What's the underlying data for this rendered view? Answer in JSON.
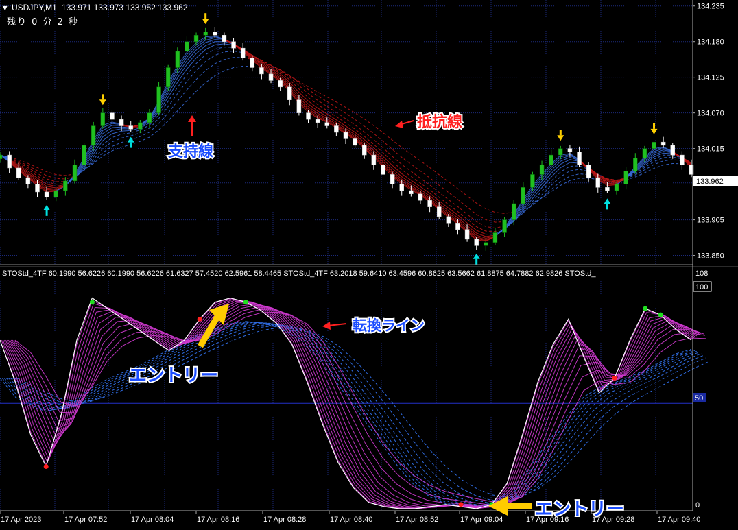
{
  "chart_header": {
    "dropdown_glyph": "▼",
    "symbol_period": "USDJPY,M1",
    "ohlc": "133.971 133.973 133.952 133.962",
    "countdown": "残り 0 分 2 秒"
  },
  "price_axis": {
    "ticks": [
      "134.235",
      "134.180",
      "134.125",
      "134.070",
      "134.015",
      "133.962",
      "133.905",
      "133.850"
    ],
    "current_price": "133.962"
  },
  "indicator_header": {
    "text": "STOStd_4TF 60.1990 56.6226 60.1990 56.6226 61.6327 57.4520 62.5961 58.4465   STOStd_4TF 63.2018 59.6410 63.4596 60.8625 63.5662 61.8875 64.7882 62.9826   STOStd_",
    "max_label": "108"
  },
  "indicator_axis": {
    "top": "100",
    "mid": "50",
    "bottom": "0"
  },
  "time_axis": {
    "labels": [
      "17 Apr 2023",
      "17 Apr 07:52",
      "17 Apr 08:04",
      "17 Apr 08:16",
      "17 Apr 08:28",
      "17 Apr 08:40",
      "17 Apr 08:52",
      "17 Apr 09:04",
      "17 Apr 09:16",
      "17 Apr 09:28",
      "17 Apr 09:40"
    ]
  },
  "annotations": {
    "support": "支持線",
    "resistance": "抵抗線",
    "turning_line": "転換ライン",
    "entry_1": "エントリー",
    "entry_2": "エントリー"
  },
  "colors": {
    "background": "#000000",
    "grid": "#1c2a7a",
    "bull_candle": "#20c020",
    "bear_candle": "#ffffff",
    "resistance_band": "#c81818",
    "support_band": "#3a6fe0",
    "stoch_fast": "#d03ad0",
    "stoch_slow": "#2f6be0",
    "sell_arrow": "#ffd000",
    "buy_arrow": "#00e0e0",
    "annotation_blue": "#1a4cff",
    "annotation_red": "#ff2020",
    "entry_arrow": "#ffcc00"
  },
  "chart_data": [
    {
      "type": "candlestick",
      "title": "USDJPY,M1",
      "ylim": [
        133.84,
        134.24
      ],
      "yticks": [
        134.235,
        134.18,
        134.125,
        134.07,
        134.015,
        133.962,
        133.905,
        133.85
      ],
      "close_series": [
        134.005,
        133.985,
        133.97,
        133.96,
        133.948,
        133.94,
        133.95,
        133.965,
        133.99,
        134.02,
        134.05,
        134.07,
        134.06,
        134.05,
        134.045,
        134.055,
        134.07,
        134.11,
        134.14,
        134.165,
        134.18,
        134.19,
        134.195,
        134.19,
        134.18,
        134.17,
        134.155,
        134.14,
        134.13,
        134.12,
        134.11,
        134.09,
        134.07,
        134.06,
        134.055,
        134.05,
        134.04,
        134.03,
        134.02,
        134.005,
        133.99,
        133.975,
        133.96,
        133.95,
        133.945,
        133.935,
        133.925,
        133.91,
        133.9,
        133.89,
        133.875,
        133.865,
        133.87,
        133.885,
        133.905,
        133.93,
        133.955,
        133.975,
        133.99,
        134.005,
        134.015,
        134.01,
        133.99,
        133.97,
        133.955,
        133.95,
        133.96,
        133.98,
        134.0,
        134.015,
        134.025,
        134.02,
        134.005,
        133.99,
        133.975
      ]
    },
    {
      "type": "line",
      "title": "STOStd_4TF",
      "ylim": [
        0,
        108
      ],
      "yticks": [
        100,
        50,
        0
      ],
      "series": [
        {
          "name": "",
          "values": [
            80,
            60,
            35,
            20,
            45,
            80,
            100,
            95,
            90,
            85,
            80,
            75,
            80,
            90,
            98,
            100,
            98,
            94,
            88,
            78,
            60,
            40,
            22,
            10,
            3,
            1,
            0,
            0,
            1,
            2,
            1,
            0,
            2,
            12,
            35,
            60,
            78,
            90,
            72,
            55,
            62,
            80,
            95,
            92,
            85,
            80
          ]
        },
        {
          "name": "",
          "values": [
            62,
            52,
            48,
            46,
            48,
            53,
            58,
            62,
            65,
            68,
            72,
            76,
            80,
            83,
            86,
            88,
            89,
            88,
            86,
            82,
            76,
            68,
            58,
            48,
            38,
            28,
            18,
            10,
            5,
            2,
            1,
            1,
            3,
            8,
            16,
            26,
            36,
            46,
            54,
            58,
            60,
            63,
            66,
            70,
            74,
            76
          ]
        }
      ]
    }
  ]
}
